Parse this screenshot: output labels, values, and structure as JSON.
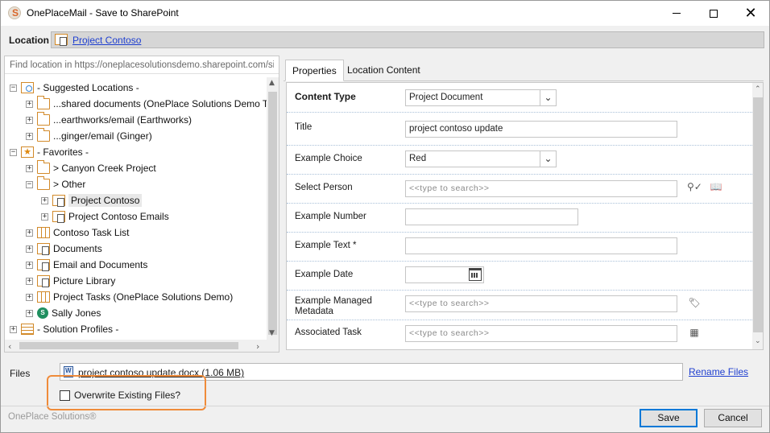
{
  "window": {
    "title": "OnePlaceMail - Save to SharePoint",
    "app_icon_letter": "S"
  },
  "location": {
    "label": "Location",
    "path": "Project Contoso"
  },
  "find": {
    "placeholder": "Find location in https://oneplacesolutionsdemo.sharepoint.com/sit"
  },
  "tree": {
    "items": [
      {
        "label": "- Suggested Locations -",
        "expander": "−"
      },
      {
        "label": "...shared documents (OnePlace Solutions Demo Team S",
        "expander": "+"
      },
      {
        "label": "...earthworks/email (Earthworks)",
        "expander": "+"
      },
      {
        "label": "...ginger/email (Ginger)",
        "expander": "+"
      },
      {
        "label": "- Favorites -",
        "expander": "−"
      },
      {
        "label": "> Canyon Creek Project",
        "expander": "+"
      },
      {
        "label": "> Other",
        "expander": "−"
      },
      {
        "label": "Project Contoso",
        "expander": "+"
      },
      {
        "label": "Project Contoso Emails",
        "expander": "+"
      },
      {
        "label": "Contoso Task List",
        "expander": "+"
      },
      {
        "label": "Documents",
        "expander": "+"
      },
      {
        "label": "Email and Documents",
        "expander": "+"
      },
      {
        "label": "Picture Library",
        "expander": "+"
      },
      {
        "label": "Project Tasks (OnePlace Solutions Demo)",
        "expander": "+"
      },
      {
        "label": "Sally Jones",
        "expander": "+"
      },
      {
        "label": "- Solution Profiles -",
        "expander": "+"
      }
    ]
  },
  "tabs": [
    "Properties",
    "Location Content"
  ],
  "form": {
    "content_type_label": "Content Type",
    "content_type_value": "Project Document",
    "title_label": "Title",
    "title_value": "project contoso update",
    "choice_label": "Example Choice",
    "choice_value": "Red",
    "person_label": "Select Person",
    "person_placeholder": "<<type to search>>",
    "number_label": "Example Number",
    "number_value": "",
    "text_label": "Example Text *",
    "text_value": "",
    "date_label": "Example Date",
    "date_value": "",
    "managed_label_1": "Example Managed",
    "managed_label_2": "Metadata",
    "managed_placeholder": "<<type to search>>",
    "task_label": "Associated Task",
    "task_placeholder": "<<type to search>>"
  },
  "files": {
    "label": "Files",
    "file_name": "project contoso update.docx (1.06 MB)",
    "rename_label": "Rename Files",
    "overwrite_label": "Overwrite Existing Files?",
    "overwrite_checked": false
  },
  "footer": {
    "brand": "OnePlace Solutions®",
    "save_label": "Save",
    "cancel_label": "Cancel"
  },
  "colors": {
    "link": "#1f3fd0",
    "highlight": "#ef8b3a",
    "primary_border": "#0078d7",
    "folder": "#d28a2a"
  }
}
